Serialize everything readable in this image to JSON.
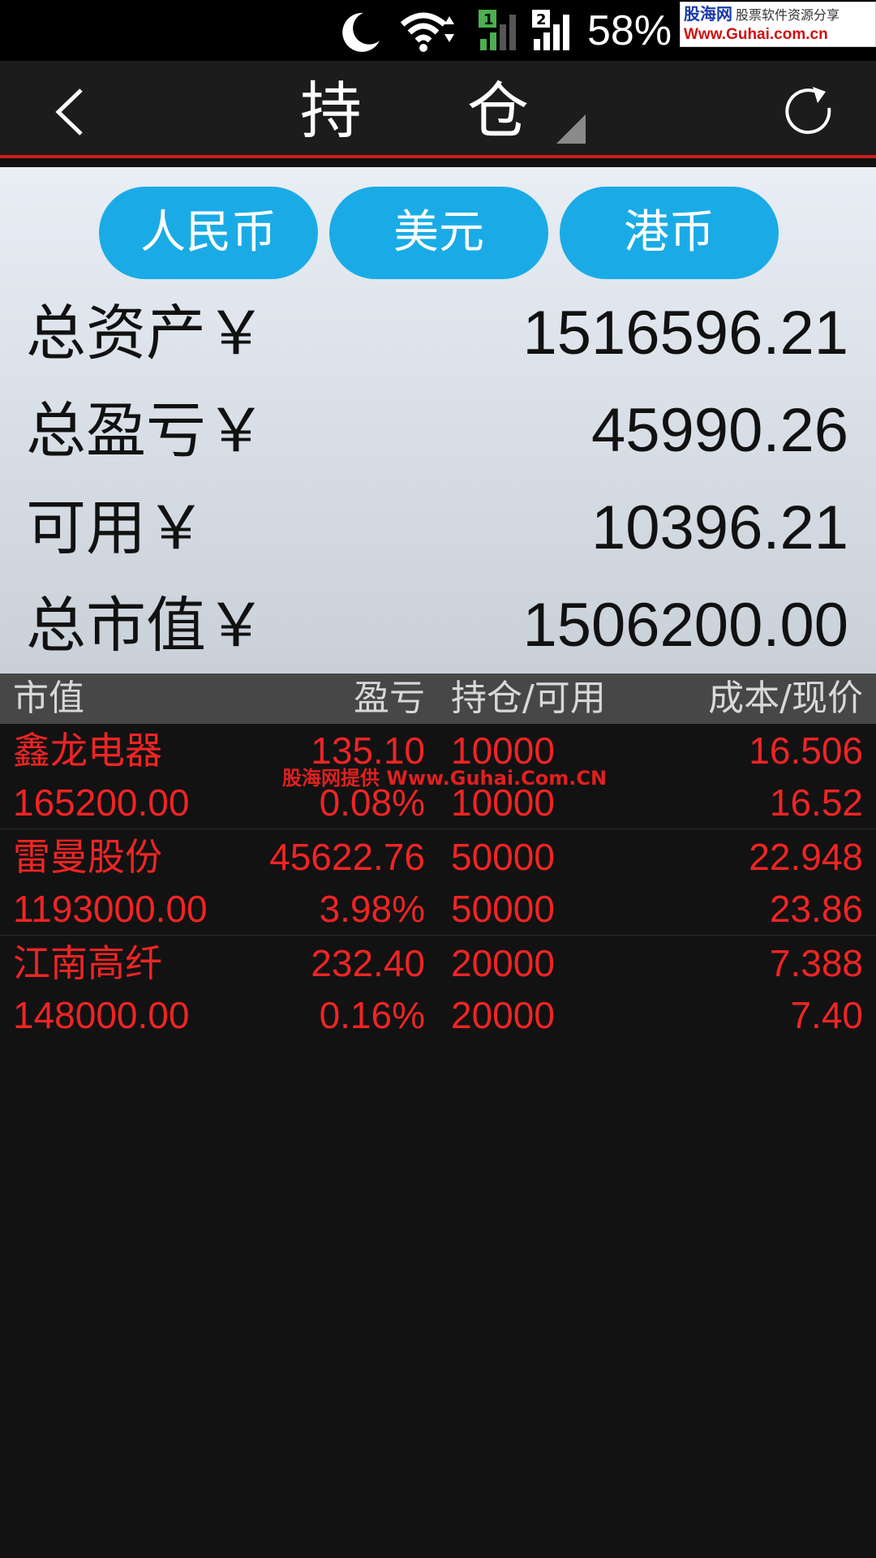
{
  "status_bar": {
    "battery_percent": "58%",
    "icons": [
      "moon-icon",
      "wifi-icon",
      "sim1-signal-icon",
      "sim2-signal-icon"
    ],
    "watermark_logo": {
      "brand": "股海网",
      "tagline": "股票软件资源分享",
      "url": "Www.Guhai.com.cn"
    }
  },
  "nav": {
    "title": "持仓",
    "back_icon": "chevron-left-icon",
    "refresh_icon": "refresh-icon"
  },
  "currency_tabs": [
    "人民币",
    "美元",
    "港币"
  ],
  "summary": [
    {
      "label": "总资产￥",
      "value": "1516596.21"
    },
    {
      "label": "总盈亏￥",
      "value": "45990.26"
    },
    {
      "label": "可用￥",
      "value": "10396.21"
    },
    {
      "label": "总市值￥",
      "value": "1506200.00"
    }
  ],
  "table": {
    "headers": {
      "market_value": "市值",
      "pl": "盈亏",
      "holding": "持仓/可用",
      "price": "成本/现价"
    },
    "rows": [
      {
        "name": "鑫龙电器",
        "pl": "135.10",
        "holding": "10000",
        "cost": "16.506",
        "market_value": "165200.00",
        "pl_pct": "0.08%",
        "available": "10000",
        "current": "16.52"
      },
      {
        "name": "雷曼股份",
        "pl": "45622.76",
        "holding": "50000",
        "cost": "22.948",
        "market_value": "1193000.00",
        "pl_pct": "3.98%",
        "available": "50000",
        "current": "23.86"
      },
      {
        "name": "江南高纤",
        "pl": "232.40",
        "holding": "20000",
        "cost": "7.388",
        "market_value": "148000.00",
        "pl_pct": "0.16%",
        "available": "20000",
        "current": "7.40"
      }
    ]
  },
  "overlay_watermark": "股海网提供 Www.Guhai.Com.CN",
  "colors": {
    "accent_blue": "#1aabe6",
    "loss_gain_red": "#f02424",
    "nav_red_line": "#c8201a"
  }
}
